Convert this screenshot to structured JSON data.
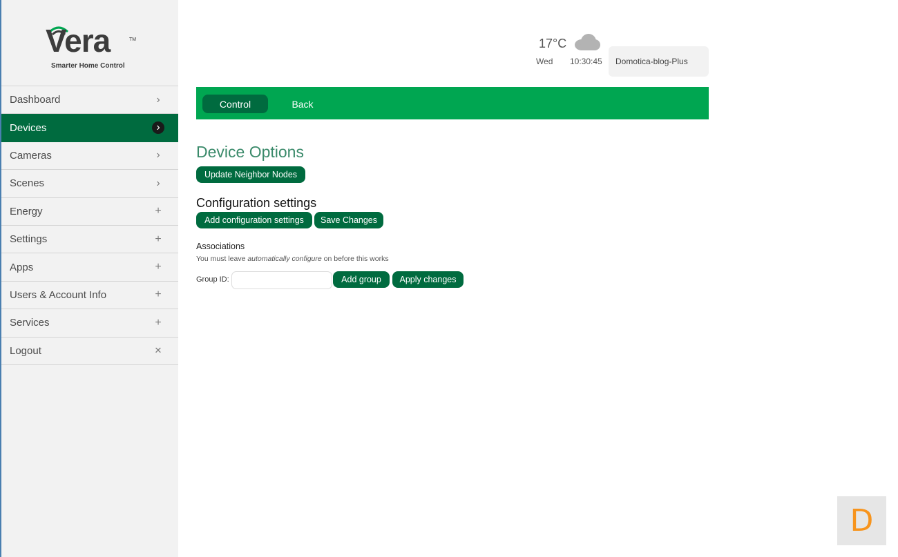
{
  "brand": {
    "name": "Vera",
    "trademark": "TM",
    "tagline": "Smarter Home Control"
  },
  "sidebar": {
    "items": [
      {
        "label": "Dashboard",
        "icon": "chevron-right-icon",
        "glyph": "›",
        "active": false
      },
      {
        "label": "Devices",
        "icon": "chevron-right-icon",
        "glyph": "›",
        "active": true
      },
      {
        "label": "Cameras",
        "icon": "chevron-right-icon",
        "glyph": "›",
        "active": false
      },
      {
        "label": "Scenes",
        "icon": "chevron-right-icon",
        "glyph": "›",
        "active": false
      },
      {
        "label": "Energy",
        "icon": "plus-icon",
        "glyph": "+",
        "active": false
      },
      {
        "label": "Settings",
        "icon": "plus-icon",
        "glyph": "+",
        "active": false
      },
      {
        "label": "Apps",
        "icon": "plus-icon",
        "glyph": "+",
        "active": false
      },
      {
        "label": "Users & Account Info",
        "icon": "plus-icon",
        "glyph": "+",
        "active": false
      },
      {
        "label": "Services",
        "icon": "plus-icon",
        "glyph": "+",
        "active": false
      },
      {
        "label": "Logout",
        "icon": "close-icon",
        "glyph": "✕",
        "active": false
      }
    ]
  },
  "header": {
    "temperature": "17°C",
    "weather_icon": "cloud-icon",
    "day": "Wed",
    "time": "10:30:45",
    "unit_name": "Domotica-blog-Plus"
  },
  "toolbar": {
    "control_label": "Control",
    "back_label": "Back"
  },
  "main": {
    "title": "Device Options",
    "update_neighbor_label": "Update Neighbor Nodes",
    "config_title": "Configuration settings",
    "add_config_label": "Add configuration settings",
    "save_changes_label": "Save Changes",
    "associations_title": "Associations",
    "assoc_note_before": "You must leave ",
    "assoc_note_em": "automatically configure",
    "assoc_note_after": " on before this works",
    "group_id_label": "Group ID:",
    "group_id_value": "",
    "add_group_label": "Add group",
    "apply_changes_label": "Apply changes"
  },
  "badge": {
    "letter": "D"
  },
  "colors": {
    "brand_green": "#00a651",
    "dark_green": "#006b3f",
    "title_green": "#3a8a6a",
    "badge_orange": "#f7941d",
    "sidebar_bg": "#f2f2f2"
  }
}
